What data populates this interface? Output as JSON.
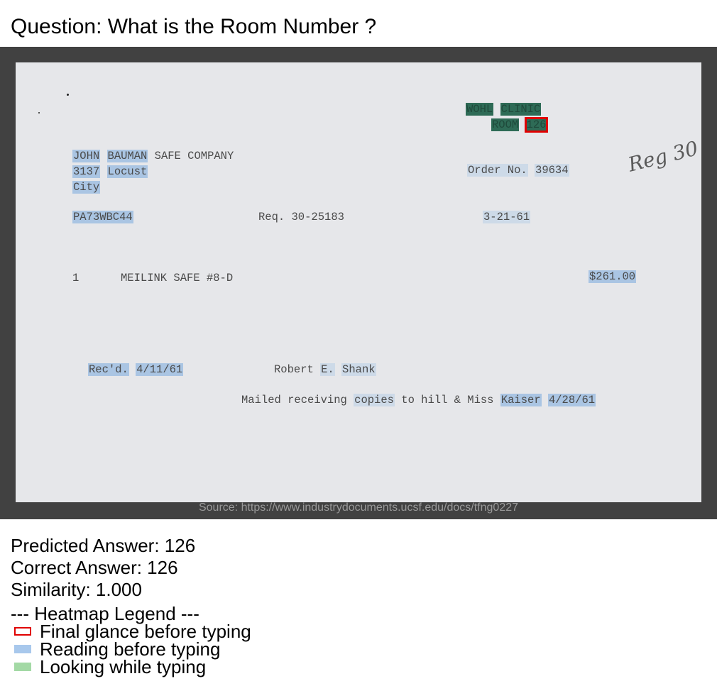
{
  "question": "Question: What is the Room Number ?",
  "document": {
    "header": {
      "clinic_words": [
        "WOHL",
        "CLINIC"
      ],
      "room_label": "ROOM",
      "room_number": "126"
    },
    "handwritten_note": "Reg 30",
    "company": {
      "name_first": "JOHN",
      "name_last": "BAUMAN",
      "name_rest": "SAFE COMPANY",
      "street_number": "3137",
      "street_name": "Locust",
      "city": "City"
    },
    "order_label": "Order No.",
    "order_number": "39634",
    "code": "PA73WBC44",
    "req": "Req. 30-25183",
    "date": "3-21-61",
    "line_item": {
      "qty": "1",
      "description": "MEILINK SAFE #8-D",
      "amount": "$261.00"
    },
    "received_label": "Rec'd.",
    "received_date": "4/11/61",
    "signer_first": "Robert",
    "signer_initial": "E.",
    "signer_last": "Shank",
    "mailed_text": "Mailed receiving",
    "mailed_copies": "copies",
    "mailed_rest": "to hill & Miss",
    "mailed_name": "Kaiser",
    "mailed_date": "4/28/61"
  },
  "source": "Source: https://www.industrydocuments.ucsf.edu/docs/tfng0227",
  "predicted_answer": "Predicted Answer: 126",
  "correct_answer": "Correct Answer: 126",
  "similarity": "Similarity: 1.000",
  "legend": {
    "title": "--- Heatmap Legend ---",
    "items": [
      {
        "label": "Final glance before typing",
        "color": "#e00000"
      },
      {
        "label": "Reading before typing",
        "color": "#a8c8ec"
      },
      {
        "label": "Looking while typing",
        "color": "#a3d9a5"
      }
    ]
  }
}
